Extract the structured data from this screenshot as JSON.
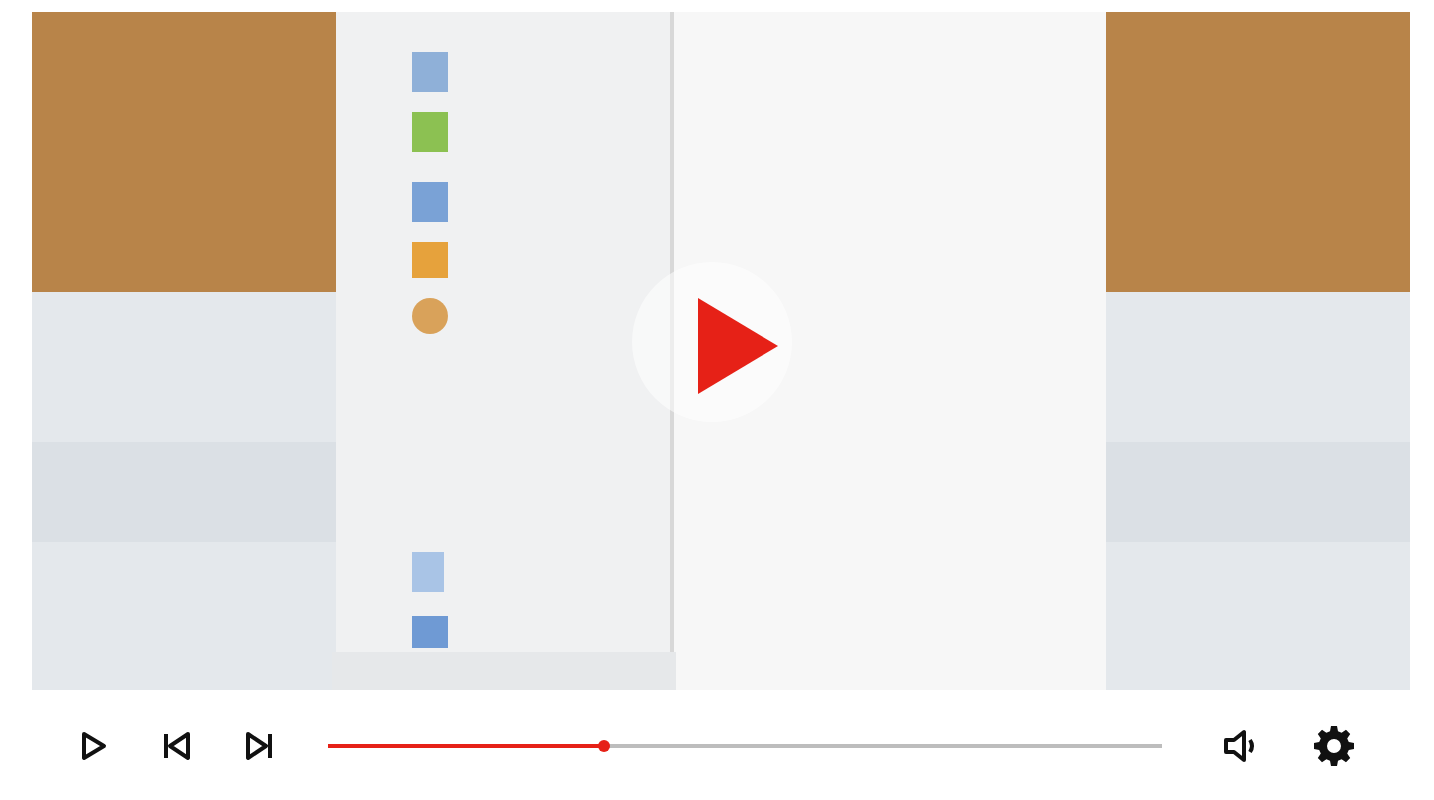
{
  "player": {
    "progress": {
      "level": 0.33
    }
  }
}
